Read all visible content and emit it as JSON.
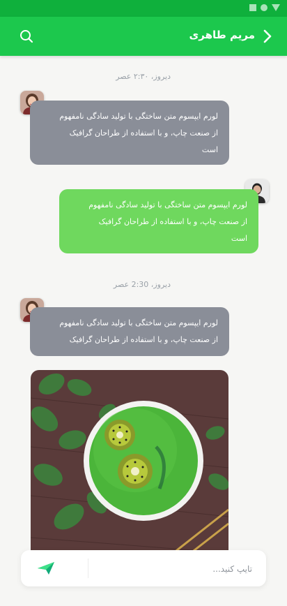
{
  "header": {
    "title": "مریم طاهری",
    "back_icon": "chevron-right-icon",
    "search_icon": "search-icon",
    "background": "#1cc84d"
  },
  "status_bar": {
    "color": "#0fb03c"
  },
  "messages": [
    {
      "type": "date",
      "text": "دیروز، ۲:۳۰ عصر"
    },
    {
      "type": "text",
      "side": "received",
      "color": "#8a8e98",
      "lines": [
        "لورم ایپسوم متن ساختگی با تولید سادگی نامفهوم",
        "از صنعت چاپ، و با استفاده از طراحان گرافیک",
        "است"
      ]
    },
    {
      "type": "text",
      "side": "sent",
      "color": "#6fd85e",
      "lines": [
        "لورم ایپسوم متن ساختگی با تولید سادگی نامفهوم",
        "از صنعت چاپ، و با استفاده از طراحان گرافیک",
        "است"
      ]
    },
    {
      "type": "date",
      "text": "دیروز، 2:30 عصر"
    },
    {
      "type": "text",
      "side": "received",
      "color": "#8a8e98",
      "lines": [
        "لورم ایپسوم متن ساختگی با تولید سادگی نامفهوم",
        "از صنعت چاپ، و با استفاده از طراحان گرافیک"
      ]
    },
    {
      "type": "image",
      "side": "received",
      "subject": "green smoothie bowl with kiwi slices"
    }
  ],
  "composer": {
    "placeholder": "تایپ کنید...",
    "send_icon": "send-icon"
  }
}
